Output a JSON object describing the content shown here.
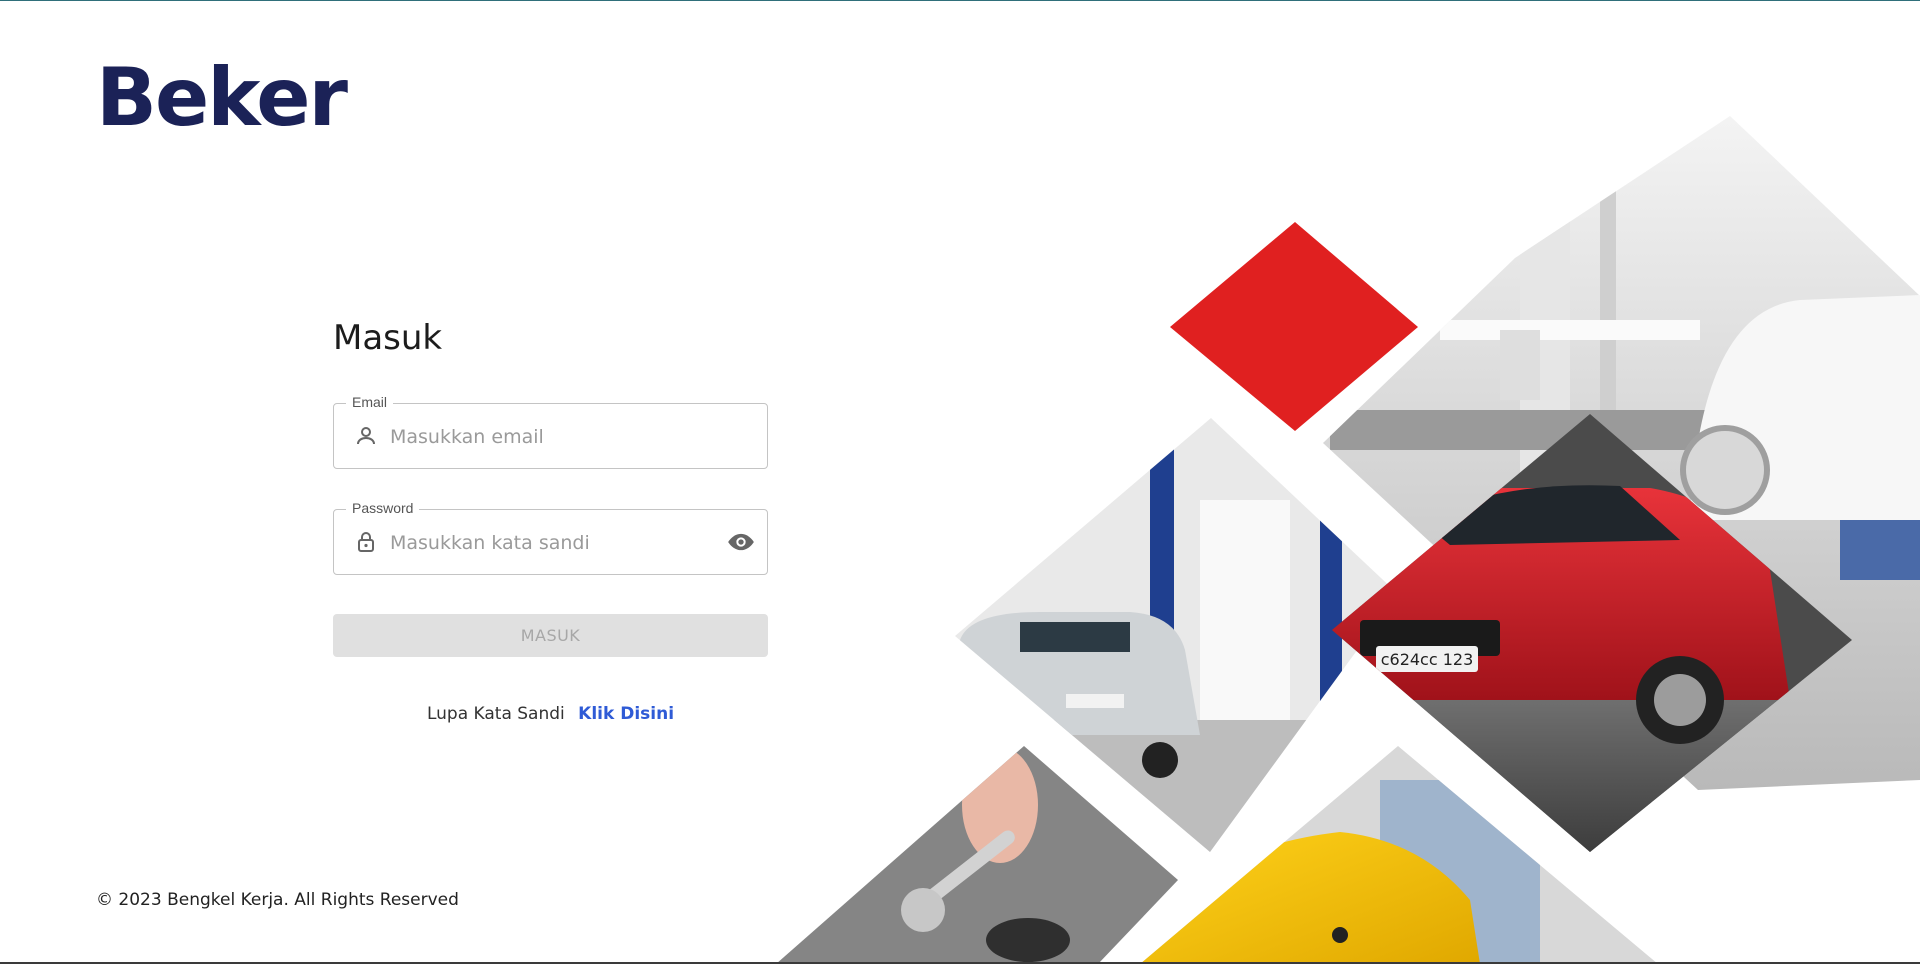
{
  "app": {
    "logo": "Beker"
  },
  "login": {
    "title": "Masuk",
    "email": {
      "label": "Email",
      "placeholder": "Masukkan email",
      "value": ""
    },
    "password": {
      "label": "Password",
      "placeholder": "Masukkan kata sandi",
      "value": ""
    },
    "submit_label": "MASUK",
    "forgot_text": "Lupa Kata Sandi",
    "forgot_link": "Klik Disini"
  },
  "footer": {
    "copyright": "© 2023 Bengkel Kerja. All Rights Reserved"
  },
  "images": {
    "plate_text": "c624cc 123"
  },
  "icons": {
    "email": "person-icon",
    "password": "lock-icon",
    "toggle": "eye-icon"
  },
  "colors": {
    "brand": "#1b2257",
    "accent_red": "#e02020",
    "link": "#2f5bd6"
  }
}
